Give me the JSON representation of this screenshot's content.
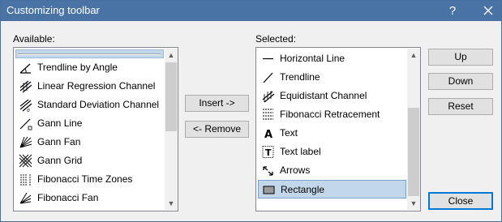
{
  "window": {
    "title": "Customizing toolbar",
    "help_label": "?"
  },
  "available": {
    "label": "Available:",
    "items": [
      {
        "label": "",
        "icon": "separator-line-icon",
        "separator": true
      },
      {
        "label": "Trendline by Angle",
        "icon": "trendline-by-angle-icon"
      },
      {
        "label": "Linear Regression Channel",
        "icon": "linear-regression-channel-icon"
      },
      {
        "label": "Standard Deviation Channel",
        "icon": "standard-deviation-channel-icon"
      },
      {
        "label": "Gann Line",
        "icon": "gann-line-icon"
      },
      {
        "label": "Gann Fan",
        "icon": "gann-fan-icon"
      },
      {
        "label": "Gann Grid",
        "icon": "gann-grid-icon"
      },
      {
        "label": "Fibonacci Time Zones",
        "icon": "fibonacci-time-zones-icon"
      },
      {
        "label": "Fibonacci Fan",
        "icon": "fibonacci-fan-icon"
      }
    ]
  },
  "selected": {
    "label": "Selected:",
    "items": [
      {
        "label": "Horizontal Line",
        "icon": "horizontal-line-icon"
      },
      {
        "label": "Trendline",
        "icon": "trendline-icon"
      },
      {
        "label": "Equidistant Channel",
        "icon": "equidistant-channel-icon"
      },
      {
        "label": "Fibonacci Retracement",
        "icon": "fibonacci-retracement-icon"
      },
      {
        "label": "Text",
        "icon": "text-icon",
        "glyph": "A"
      },
      {
        "label": "Text label",
        "icon": "text-label-icon",
        "glyph": "T"
      },
      {
        "label": "Arrows",
        "icon": "arrows-icon"
      },
      {
        "label": "Rectangle",
        "icon": "rectangle-icon",
        "selected": true
      }
    ]
  },
  "buttons": {
    "insert": "Insert ->",
    "remove": "<- Remove",
    "up": "Up",
    "down": "Down",
    "reset": "Reset",
    "close": "Close"
  },
  "scroll_arrows": {
    "up": "▲",
    "down": "▼"
  }
}
